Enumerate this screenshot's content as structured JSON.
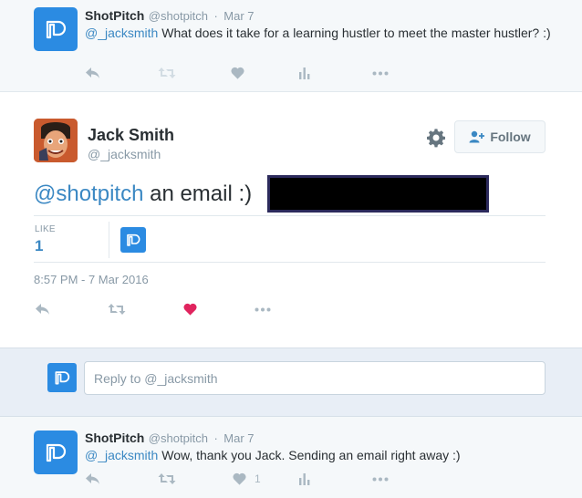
{
  "top_tweet": {
    "name": "ShotPitch",
    "handle": "@shotpitch",
    "dot": "·",
    "time": "Mar 7",
    "mention": "@_jacksmith",
    "text": " What does it take for a learning hustler to meet the master hustler? :)"
  },
  "main_tweet": {
    "name": "Jack Smith",
    "handle": "@_jacksmith",
    "follow_label": "Follow",
    "mention": "@shotpitch",
    "text": " an email :)",
    "like_label": "LIKE",
    "like_count": "1",
    "timestamp": "8:57 PM - 7 Mar 2016",
    "liked_color": "#e0245e"
  },
  "reply_box": {
    "placeholder": "Reply to @_jacksmith"
  },
  "bottom_tweet": {
    "name": "ShotPitch",
    "handle": "@shotpitch",
    "dot": "·",
    "time": "Mar 7",
    "mention": "@_jacksmith",
    "text": " Wow, thank you Jack. Sending an email right away :)",
    "like_count": "1"
  },
  "colors": {
    "brand": "#2b8be2",
    "link": "#3b88c3",
    "muted": "#aab8c2"
  }
}
